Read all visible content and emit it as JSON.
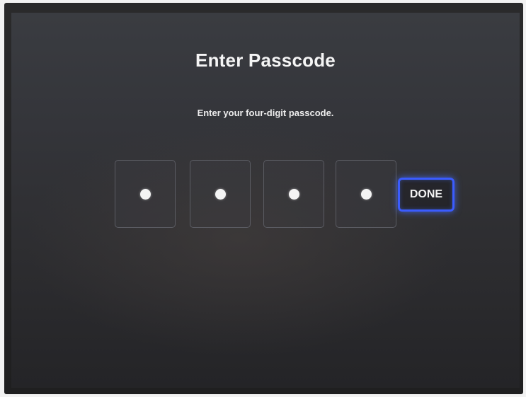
{
  "screen": {
    "title": "Enter Passcode",
    "subtitle": "Enter your four-digit passcode.",
    "digits": [
      {
        "filled": true
      },
      {
        "filled": true
      },
      {
        "filled": true
      },
      {
        "filled": true
      }
    ],
    "done_label": "DONE"
  },
  "colors": {
    "background": "#2f3034",
    "text": "#f5f5f5",
    "focus_outline": "#3b5cff",
    "box_border": "#5b5c63"
  }
}
